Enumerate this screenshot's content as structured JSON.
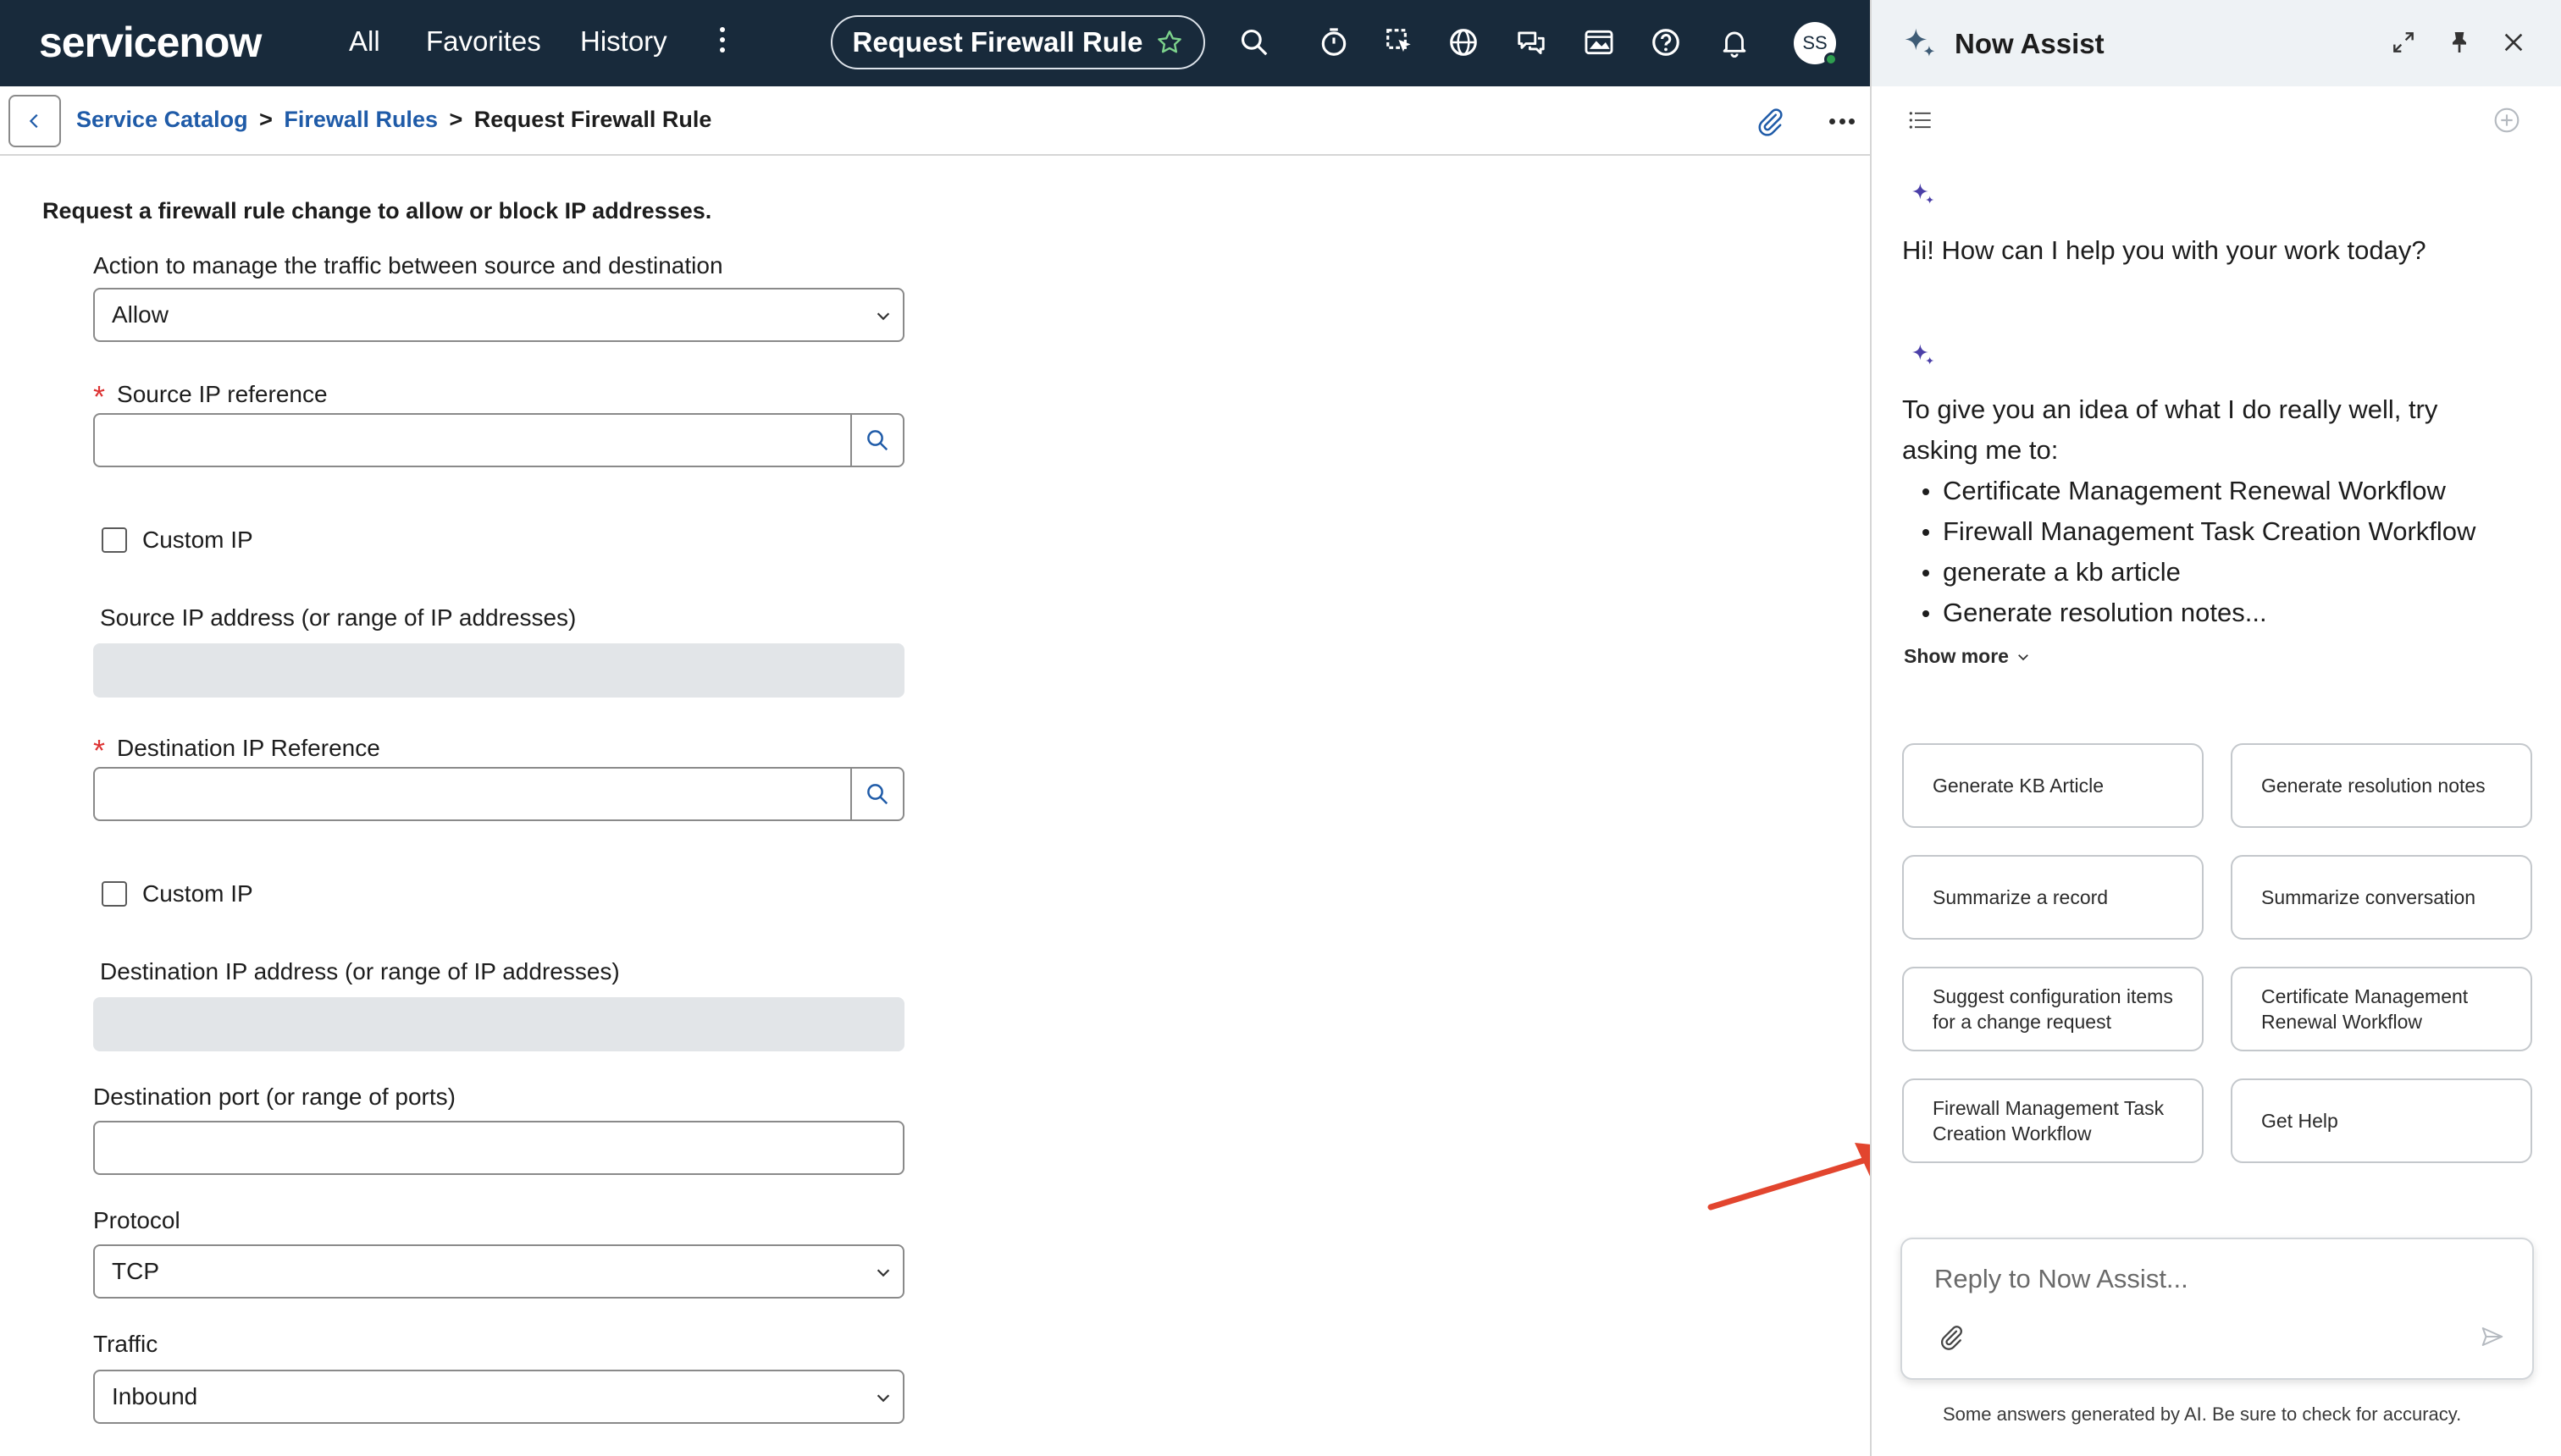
{
  "topnav": {
    "logo": "servicenow",
    "links": [
      "All",
      "Favorites",
      "History"
    ],
    "title": "Request Firewall Rule",
    "avatar_initials": "SS"
  },
  "breadcrumb": {
    "items": [
      "Service Catalog",
      "Firewall Rules"
    ],
    "current": "Request Firewall Rule",
    "separator": ">"
  },
  "form": {
    "intro": "Request a firewall rule change to allow or block IP addresses.",
    "action_label": "Action to manage the traffic between source and destination",
    "action_value": "Allow",
    "source_ref_label": "Source IP reference",
    "custom_ip_label_1": "Custom IP",
    "source_ip_label": "Source IP address (or range of IP addresses)",
    "dest_ref_label": "Destination IP Reference",
    "custom_ip_label_2": "Custom IP",
    "dest_ip_label": "Destination IP address (or range of IP addresses)",
    "dest_port_label": "Destination port (or range of ports)",
    "protocol_label": "Protocol",
    "protocol_value": "TCP",
    "traffic_label": "Traffic",
    "traffic_value": "Inbound",
    "required_marker": "*"
  },
  "assist": {
    "title": "Now Assist",
    "greeting": "Hi! How can I help you with your work today?",
    "intro_line1": "To give you an idea of what I do really well, try",
    "intro_line2": "asking me to:",
    "suggestions": [
      "Certificate Management Renewal Workflow",
      "Firewall Management Task Creation Workflow",
      "generate a kb article",
      "Generate resolution notes..."
    ],
    "show_more": "Show more",
    "chips": [
      "Generate KB Article",
      "Generate resolution notes",
      "Summarize a record",
      "Summarize conversation",
      "Suggest configuration items for a change request",
      "Certificate Management Renewal Workflow",
      "Firewall Management Task Creation Workflow",
      "Get Help"
    ],
    "reply_placeholder": "Reply to Now Assist...",
    "disclaimer": "Some answers generated by AI. Be sure to check for accuracy."
  },
  "colors": {
    "nav_bg": "#182a3b",
    "link": "#1f5ba8",
    "accent_green": "#81b5a1",
    "spark_purple": "#4b3fa8",
    "required_red": "#dd3333",
    "annotation_red": "#e2452e"
  },
  "icons": [
    "search-icon",
    "timer-icon",
    "pointer-icon",
    "globe-icon",
    "chat-icon",
    "image-icon",
    "help-icon",
    "bell-icon",
    "paperclip-icon",
    "more-icon",
    "sparkle-icon",
    "expand-icon",
    "pin-icon",
    "close-icon",
    "list-icon",
    "add-icon",
    "send-icon"
  ]
}
